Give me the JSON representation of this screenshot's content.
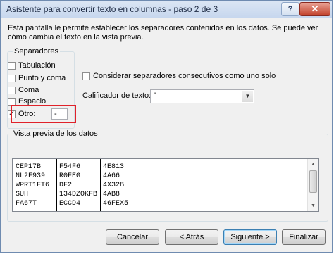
{
  "window": {
    "title": "Asistente para convertir texto en columnas - paso 2 de 3",
    "help_label": "?",
    "close_label": "✕"
  },
  "description": "Esta pantalla le permite establecer los separadores contenidos en los datos. Se puede ver cómo cambia el texto en la vista previa.",
  "separators": {
    "legend": "Separadores",
    "items": [
      {
        "label": "Tabulación",
        "checked": false
      },
      {
        "label": "Punto y coma",
        "checked": false
      },
      {
        "label": "Coma",
        "checked": false
      },
      {
        "label": "Espacio",
        "checked": false
      },
      {
        "label": "Otro:",
        "checked": true
      }
    ],
    "other_value": "-"
  },
  "consecutive_label": "Considerar separadores consecutivos como uno solo",
  "text_qualifier": {
    "label": "Calificador de texto:",
    "value": "\""
  },
  "preview": {
    "legend": "Vista previa de los datos",
    "rows": [
      [
        "CEP17B",
        "F54F6",
        "4E813"
      ],
      [
        "NL2F939",
        "R0FEG",
        "4A66"
      ],
      [
        "WPRT1FT6",
        "DF2",
        "4X32B"
      ],
      [
        "SUH",
        "134DZOKFB",
        "4AB8"
      ],
      [
        "FA67T",
        "ECCD4",
        "46FEX5"
      ]
    ]
  },
  "buttons": {
    "cancel": "Cancelar",
    "back": "< Atrás",
    "next": "Siguiente >",
    "finish": "Finalizar"
  },
  "colors": {
    "highlight": "#e0222a",
    "titlebar": "#c7d7ee"
  }
}
